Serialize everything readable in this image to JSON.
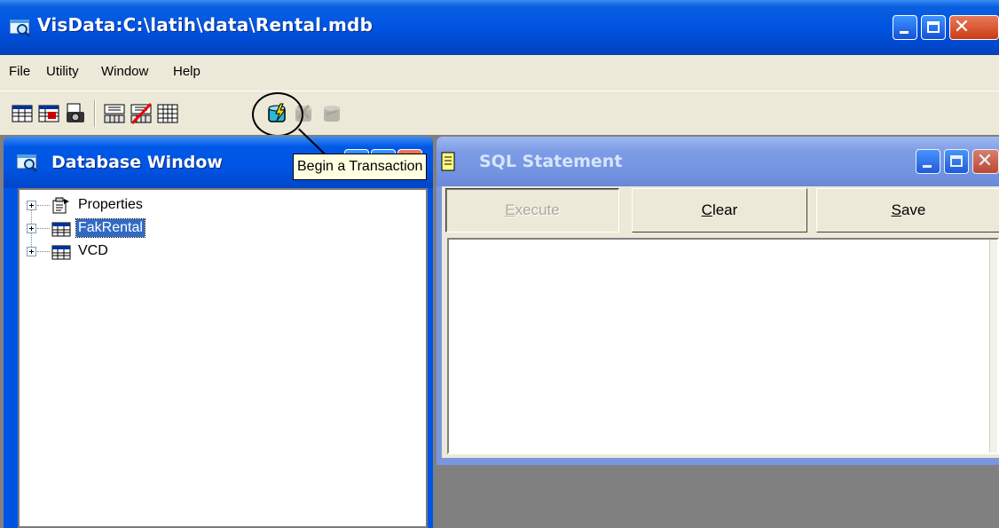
{
  "app": {
    "title": "VisData:C:\\latih\\data\\Rental.mdb",
    "icon": "database-icon",
    "accent": "#0054e3"
  },
  "window_controls": {
    "minimize": "minimize-icon",
    "maximize": "maximize-icon",
    "close": "close-icon"
  },
  "menu": {
    "items": [
      {
        "label": "File"
      },
      {
        "label": "Utility"
      },
      {
        "label": "Window"
      },
      {
        "label": "Help"
      }
    ]
  },
  "toolbar": {
    "icons": [
      "table-view-icon",
      "dynaset-view-icon",
      "snapshot-camera-icon",
      "data-control-icon",
      "no-data-control-icon",
      "grid-view-icon",
      "begin-transaction-icon",
      "commit-transaction-icon",
      "rollback-transaction-icon"
    ],
    "tooltip": "Begin a Transaction"
  },
  "database_window": {
    "title": "Database Window",
    "tree": [
      {
        "label": "Properties",
        "icon": "properties-icon",
        "selected": false
      },
      {
        "label": "FakRental",
        "icon": "table-icon",
        "selected": true
      },
      {
        "label": "VCD",
        "icon": "table-icon",
        "selected": false
      }
    ]
  },
  "sql_window": {
    "title": "SQL Statement",
    "execute": {
      "pre": "",
      "accel": "E",
      "post": "xecute"
    },
    "clear": {
      "pre": "",
      "accel": "C",
      "post": "lear"
    },
    "save": {
      "pre": "",
      "accel": "S",
      "post": "ave"
    },
    "text": ""
  }
}
